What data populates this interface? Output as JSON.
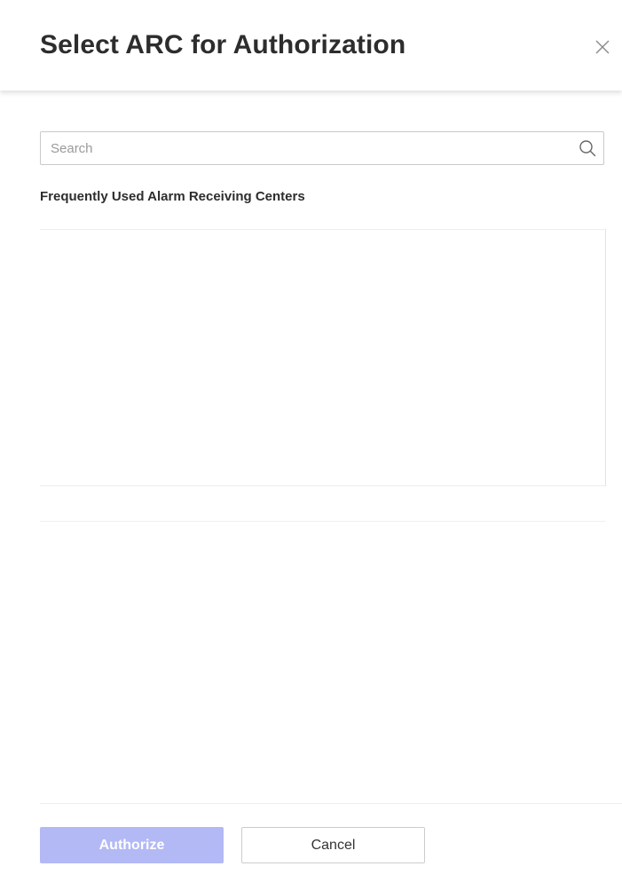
{
  "dialog": {
    "title": "Select ARC for Authorization",
    "close_icon": "close-icon"
  },
  "search": {
    "placeholder": "Search",
    "value": "",
    "icon": "search-icon"
  },
  "section": {
    "label": "Frequently Used Alarm Receiving Centers",
    "items": []
  },
  "footer": {
    "authorize_label": "Authorize",
    "authorize_disabled": true,
    "cancel_label": "Cancel"
  },
  "colors": {
    "primary_disabled": "#b3b9f5",
    "title_text": "#2d2d2d",
    "border": "#c9c9c9"
  }
}
